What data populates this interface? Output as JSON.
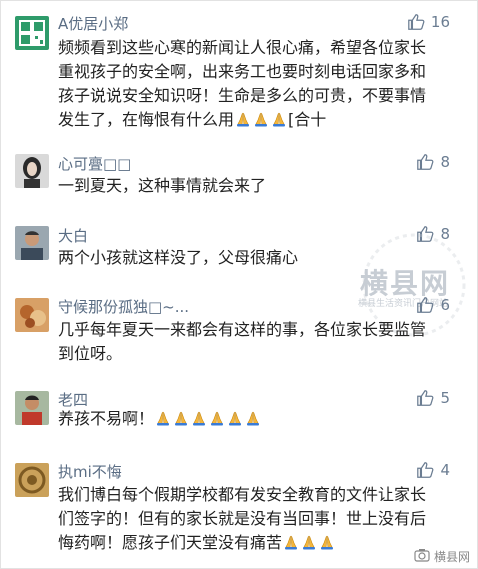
{
  "comments": [
    {
      "name": "A优居小郑",
      "likes": "16",
      "lines": [
        "频频看到这些心寒的新闻让人很心痛，希望各位家长",
        "重视孩子的安全啊，出来务工也要时刻电话回家多和",
        "孩子说说安全知识呀！生命是多么的可贵，不要事情"
      ],
      "last_pre": "发生了，在悔恨有什么用",
      "last_post": "[合十",
      "pray_count": 3,
      "avatar": "qr-avatar"
    },
    {
      "name": "心可亹□□",
      "likes": "8",
      "lines": [
        "一到夏天，这种事情就会来了"
      ],
      "avatar": "woman-avatar"
    },
    {
      "name": "大白",
      "likes": "8",
      "lines": [
        "两个小孩就这样没了，父母很痛心"
      ],
      "avatar": "man-avatar"
    },
    {
      "name": "守候那份孤独□~...",
      "likes": "6",
      "lines": [
        "几乎每年夏天一来都会有这样的事，各位家长要监管",
        "到位呀。"
      ],
      "avatar": "food-avatar"
    },
    {
      "name": "老四",
      "likes": "5",
      "text_pre": "养孩不易啊！",
      "pray_count": 6,
      "avatar": "person-avatar"
    },
    {
      "name": "执mi不悔",
      "likes": "4",
      "lines": [
        "我们博白每个假期学校都有发安全教育的文件让家长",
        "们签字的！但有的家长就是没有当回事！世上没有后"
      ],
      "last_pre": "悔药啊！愿孩子们天堂没有痛苦",
      "pray_count": 3,
      "avatar": "ornament-avatar"
    }
  ],
  "watermark": {
    "main": "横县网",
    "sub": "横县生活资讯门户网站"
  },
  "footer": {
    "label": "横县网"
  }
}
